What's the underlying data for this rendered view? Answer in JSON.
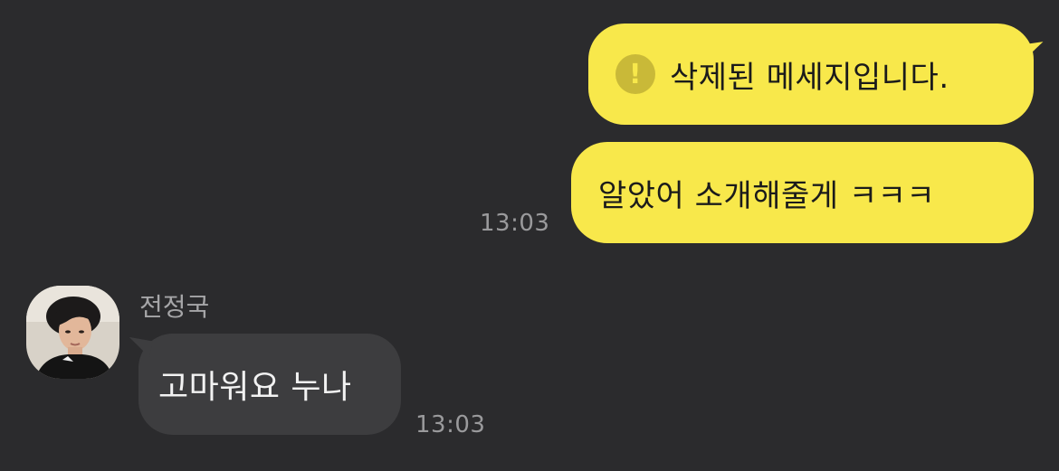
{
  "messages": {
    "sent_deleted": {
      "icon": "exclamation-circle-icon",
      "icon_glyph": "!",
      "text": "삭제된 메세지입니다."
    },
    "sent_reply": {
      "text": "알았어 소개해줄게 ㅋㅋㅋ",
      "time": "13:03"
    },
    "received": {
      "sender": "전정국",
      "text": "고마워요 누나",
      "time": "13:03"
    }
  },
  "colors": {
    "background": "#2b2b2d",
    "sent_bubble": "#f8e84b",
    "received_bubble": "#3d3d3f",
    "timestamp": "#9a9a9c"
  }
}
